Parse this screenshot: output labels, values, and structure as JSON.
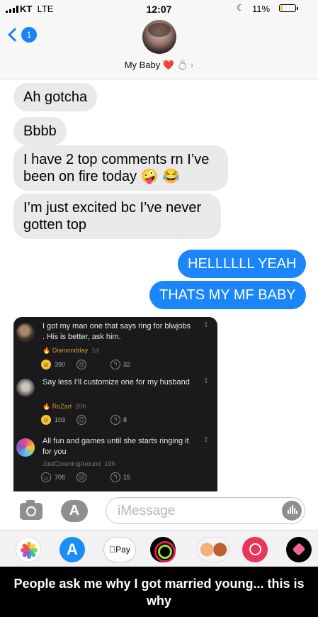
{
  "status": {
    "carrier": "KT",
    "network": "LTE",
    "time": "12:07",
    "battery": "11%",
    "battery_level": 0.11
  },
  "header": {
    "back_count": "1",
    "contact_name": "My Baby",
    "contact_emoji": "❤️ 💍"
  },
  "messages": [
    {
      "direction": "incoming",
      "text": "Ah gotcha"
    },
    {
      "direction": "incoming",
      "text": "Bbbb"
    },
    {
      "direction": "incoming",
      "text": "I have 2 top comments rn I’ve been on fire today 🤪 😂"
    },
    {
      "direction": "incoming",
      "text": "I’m just excited bc I’ve never gotten top"
    },
    {
      "direction": "outgoing",
      "text": "HELLLLLL YEAH"
    },
    {
      "direction": "outgoing",
      "text": "THATS MY MF BABY"
    }
  ],
  "embedded_comments": [
    {
      "text": "I got my man one that says ring for blwjobs . His is better, ask him.",
      "user": "Diamondday",
      "age": "1d",
      "likes": "390",
      "replies": "32"
    },
    {
      "text": "Say less I’ll customize one for my husband",
      "user": "RoZart",
      "age": "20h",
      "likes": "103",
      "replies": "8"
    },
    {
      "text": "All fun and games until she starts ringing it for you",
      "user": "JustClowningAround",
      "age": "19h",
      "likes": "706",
      "replies": "15"
    }
  ],
  "input": {
    "placeholder": "iMessage"
  },
  "tray": {
    "apple_pay_label": "Pay"
  },
  "caption": "People ask me why I got married young... this is why",
  "colors": {
    "blue": "#1b86f9",
    "incoming_bubble": "#e9e9eb",
    "gold": "#c79b2b"
  }
}
